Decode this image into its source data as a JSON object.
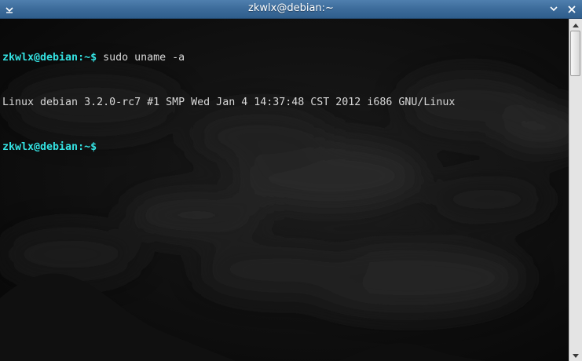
{
  "window": {
    "title": "zkwlx@debian:~",
    "menu_icon": "chevron-down-icon",
    "minimize_icon": "minimize-icon",
    "close_icon": "close-icon"
  },
  "terminal": {
    "lines": [
      {
        "prompt": "zkwlx@debian:~$",
        "text": " sudo uname -a"
      },
      {
        "prompt": "",
        "text": "Linux debian 3.2.0-rc7 #1 SMP Wed Jan 4 14:37:48 CST 2012 i686 GNU/Linux"
      },
      {
        "prompt": "zkwlx@debian:~$",
        "text": " "
      }
    ],
    "background": "dark cloudy night sky wallpaper",
    "prompt_color": "#34e2e2",
    "text_color": "#d8d8d8"
  },
  "scrollbar": {
    "up_icon": "arrow-up-icon",
    "down_icon": "arrow-down-icon"
  },
  "colors": {
    "titlebar": "#3c6b9a",
    "terminal_bg": "#050505",
    "scrollbar_bg": "#e4e4e4"
  }
}
